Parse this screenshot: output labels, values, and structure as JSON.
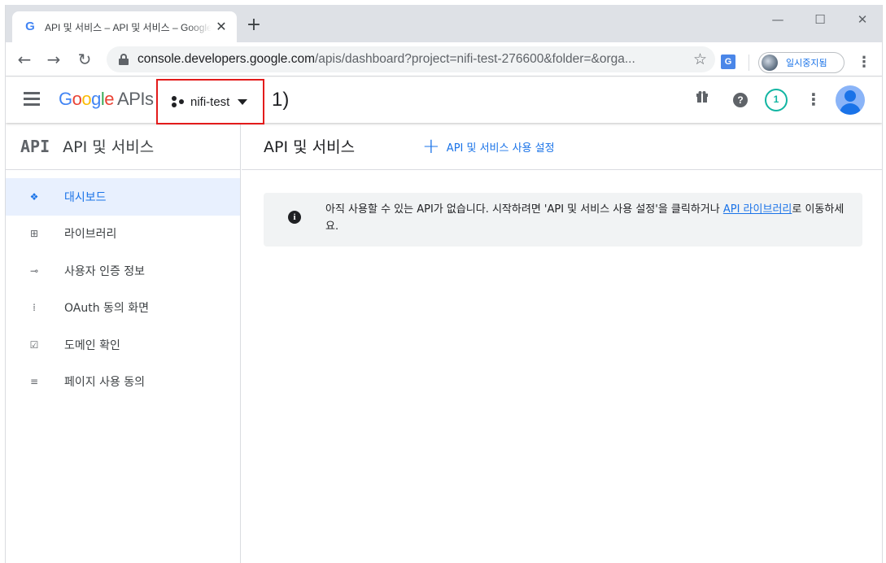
{
  "browser": {
    "tab_title": "API 및 서비스 – API 및 서비스 – Google Cloud",
    "tab_close": "✕",
    "new_tab": "+",
    "url_domain": "console.developers.google.com",
    "url_path": "/apis/dashboard?project=nifi-test-276600&folder=&orga...",
    "profile_label": "일시중지됨",
    "window_controls": {
      "minimize": "—",
      "maximize": "☐",
      "close": "✕"
    }
  },
  "header": {
    "logo_parts": [
      "G",
      "o",
      "o",
      "g",
      "l",
      "e"
    ],
    "logo_suffix": "APIs",
    "project_name": "nifi-test",
    "step_marker": "1)",
    "notification_count": "1"
  },
  "sidebar": {
    "api_logo": "API",
    "title": "API 및 서비스",
    "items": [
      {
        "label": "대시보드",
        "icon": "dashboard-icon",
        "glyph": "❖",
        "active": true
      },
      {
        "label": "라이브러리",
        "icon": "library-icon",
        "glyph": "⊞",
        "active": false
      },
      {
        "label": "사용자 인증 정보",
        "icon": "key-icon",
        "glyph": "⊸",
        "active": false
      },
      {
        "label": "OAuth 동의 화면",
        "icon": "consent-icon",
        "glyph": "⁞",
        "active": false
      },
      {
        "label": "도메인 확인",
        "icon": "domain-check-icon",
        "glyph": "☑",
        "active": false
      },
      {
        "label": "페이지 사용 동의",
        "icon": "page-settings-icon",
        "glyph": "≡",
        "active": false
      }
    ]
  },
  "main": {
    "title": "API 및 서비스",
    "enable_button": "API 및 서비스 사용 설정",
    "info": {
      "text_before": "아직 사용할 수 있는 API가 없습니다. 시작하려면 'API 및 서비스 사용 설정'을 클릭하거나 ",
      "link": "API 라이브러리",
      "text_after": "로 이동하세요."
    }
  },
  "colors": {
    "accent": "#1a73e8",
    "highlight_box": "#e31b1b",
    "notification": "#12b5a2",
    "active_row": "#e8f0fe"
  }
}
